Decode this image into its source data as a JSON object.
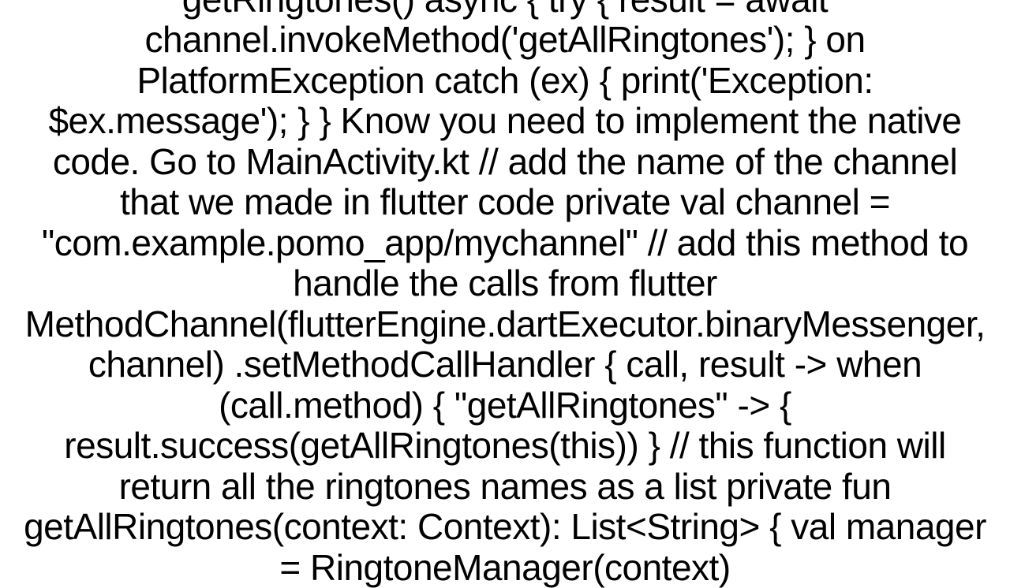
{
  "document": {
    "text": "getRingtones() async {     try {       result = await channel.invokeMethod('getAllRingtones');     } on PlatformException catch (ex) {       print('Exception: $ex.message');     }   }    Know you need to implement the native code. Go to MainActivity.kt // add the name of the channel that we made in flutter code private val channel = \"com.example.pomo_app/mychannel\"  // add this method to handle the calls from flutter  MethodChannel(flutterEngine.dartExecutor.binaryMessenger, channel)   .setMethodCallHandler { call, result ->             when (call.method) {                 \"getAllRingtones\" -> {                     result.success(getAllRingtones(this))                 }  // this function will return all the ringtones names as a list private fun getAllRingtones(context: Context): List<String> {    val manager = RingtoneManager(context)"
  }
}
